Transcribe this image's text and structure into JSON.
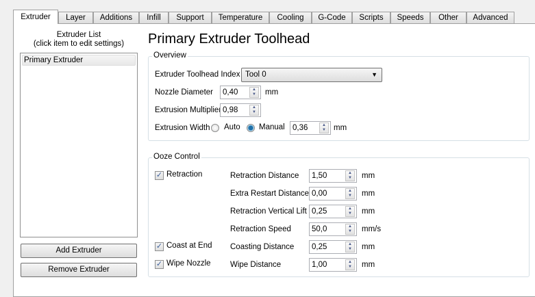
{
  "tabs": [
    "Extruder",
    "Layer",
    "Additions",
    "Infill",
    "Support",
    "Temperature",
    "Cooling",
    "G-Code",
    "Scripts",
    "Speeds",
    "Other",
    "Advanced"
  ],
  "selected_tab": "Extruder",
  "extruder_list": {
    "title_line1": "Extruder List",
    "title_line2": "(click item to edit settings)",
    "items": [
      "Primary Extruder"
    ],
    "add_label": "Add Extruder",
    "remove_label": "Remove Extruder"
  },
  "title": "Primary Extruder Toolhead",
  "overview": {
    "legend": "Overview",
    "toolhead_label": "Extruder Toolhead Index",
    "toolhead_value": "Tool 0",
    "nozzle_label": "Nozzle Diameter",
    "nozzle_value": "0,40",
    "nozzle_unit": "mm",
    "multiplier_label": "Extrusion Multiplier",
    "multiplier_value": "0,98",
    "width_label": "Extrusion Width",
    "auto_label": "Auto",
    "manual_label": "Manual",
    "width_mode": "Manual",
    "width_value": "0,36",
    "width_unit": "mm"
  },
  "ooze": {
    "legend": "Ooze Control",
    "checks": [
      {
        "label": "Retraction",
        "checked": true
      },
      {
        "label": "Coast at End",
        "checked": true
      },
      {
        "label": "Wipe Nozzle",
        "checked": true
      }
    ],
    "rows": [
      {
        "label": "Retraction Distance",
        "value": "1,50",
        "unit": "mm"
      },
      {
        "label": "Extra Restart Distance",
        "value": "0,00",
        "unit": "mm"
      },
      {
        "label": "Retraction Vertical Lift",
        "value": "0,25",
        "unit": "mm"
      },
      {
        "label": "Retraction Speed",
        "value": "50,0",
        "unit": "mm/s"
      },
      {
        "label": "Coasting Distance",
        "value": "0,25",
        "unit": "mm"
      },
      {
        "label": "Wipe Distance",
        "value": "1,00",
        "unit": "mm"
      }
    ]
  }
}
